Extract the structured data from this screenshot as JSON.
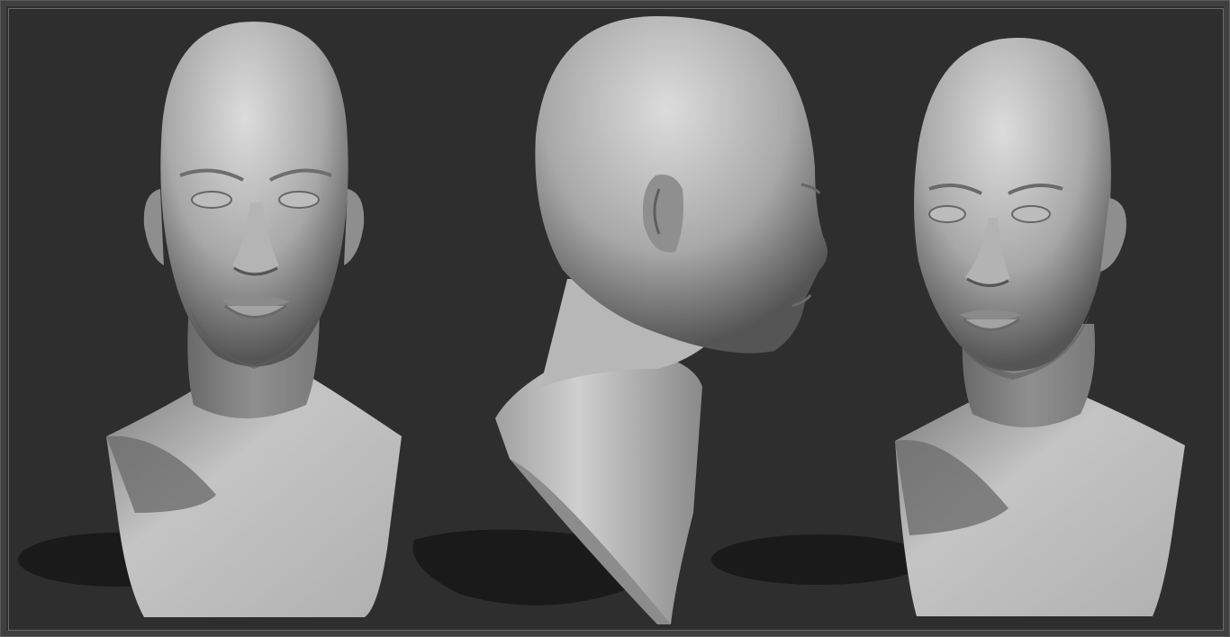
{
  "scene": {
    "description_label": "",
    "background_color": "#2e2e2e",
    "frame_color": "#5a5a5a",
    "material_light": "#d8d8d8",
    "material_mid": "#9c9c9c",
    "material_dark": "#4a4a4a",
    "shadow_color": "#1a1a1a",
    "views": [
      {
        "id": "front"
      },
      {
        "id": "side"
      },
      {
        "id": "three-quarter"
      }
    ]
  }
}
